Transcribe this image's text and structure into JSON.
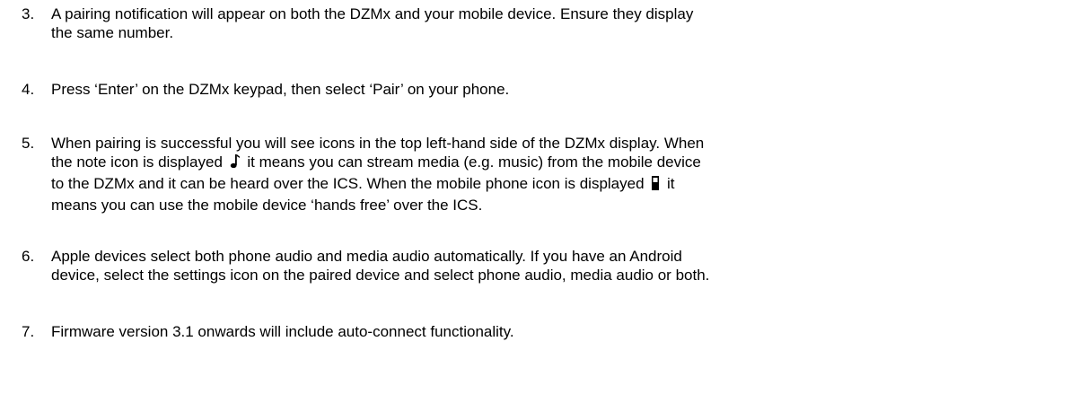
{
  "steps": [
    {
      "number": "3.",
      "lines": [
        "A pairing notification will appear on both the DZMx and your mobile device. Ensure they display",
        "the same number."
      ]
    },
    {
      "number": "4.",
      "lines": [
        "Press ‘Enter’ on the DZMx keypad, then select ‘Pair’ on your phone."
      ]
    },
    {
      "number": "5.",
      "lines": [
        "When pairing is successful you will see icons in the top left-hand side of the DZMx display. When"
      ],
      "line2_before_icon": "the note icon is displayed",
      "line2_after_icon": "it means you can stream media (e.g. music) from the mobile device",
      "line3": "to the DZMx and it can be heard over the ICS. When the mobile phone icon is displayed",
      "line3_after_icon": "it",
      "line4": "means you can use the mobile device ‘hands free’ over the ICS.",
      "icons": [
        "music-note-icon",
        "mobile-phone-icon"
      ]
    },
    {
      "number": "6.",
      "lines": [
        "Apple devices select both phone audio and media audio automatically. If you have an Android",
        "device, select the settings icon on the paired device and select phone audio, media audio or both."
      ]
    },
    {
      "number": "7.",
      "lines": [
        "Firmware version 3.1 onwards will include auto-connect functionality."
      ]
    }
  ]
}
